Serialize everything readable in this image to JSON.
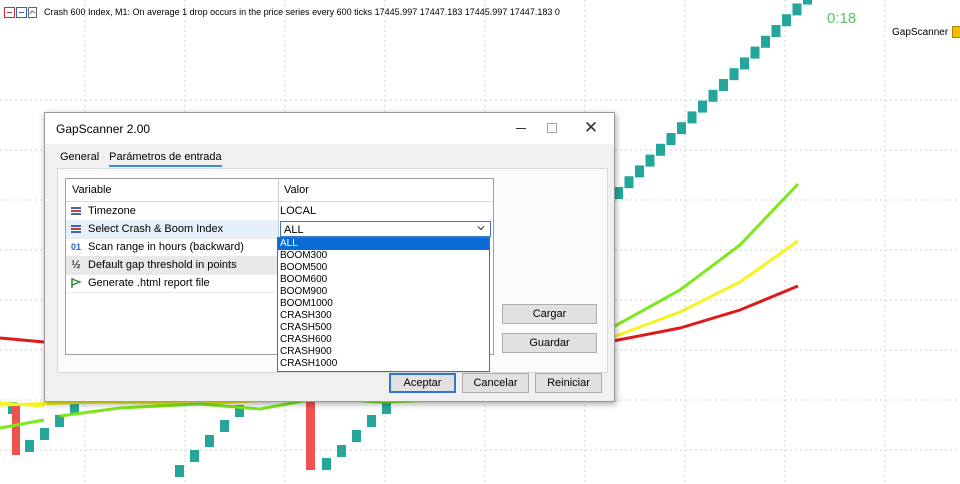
{
  "chart": {
    "header_text": "Crash 600 Index, M1:  On average 1 drop occurs in the price series every 600 ticks  17445.997 17447.183 17445.997 17447.183  0",
    "timer": "0:18",
    "ea_name": "GapScanner",
    "colors": {
      "bull_candle": "#26a69a",
      "bear_candle": "#ef5350",
      "ma_green": "#7de81c",
      "ma_yellow": "#f5f51e",
      "ma_red": "#e01919",
      "grid": "#d2d2d2"
    }
  },
  "dialog": {
    "title": "GapScanner 2.00",
    "close_glyph": "✕",
    "tabs": [
      {
        "label": "General",
        "active": false
      },
      {
        "label": "Parámetros de entrada",
        "active": true
      }
    ],
    "grid": {
      "headers": {
        "variable": "Variable",
        "value": "Valor"
      },
      "rows": [
        {
          "label": "Timezone",
          "value": "LOCAL",
          "icon": "enum-icon"
        },
        {
          "label": "Select Crash & Boom Index",
          "value": "ALL",
          "icon": "enum-icon"
        },
        {
          "label": "Scan range in hours (backward)",
          "value": "",
          "icon": "integer-icon",
          "icon_text": "01"
        },
        {
          "label": "Default gap threshold in points",
          "value": "",
          "icon": "fraction-icon",
          "icon_text": "½"
        },
        {
          "label": "Generate .html report file",
          "value": "",
          "icon": "bool-icon"
        }
      ]
    },
    "dropdown_options": [
      "ALL",
      "BOOM300",
      "BOOM500",
      "BOOM600",
      "BOOM900",
      "BOOM1000",
      "CRASH300",
      "CRASH500",
      "CRASH600",
      "CRASH900",
      "CRASH1000"
    ],
    "dropdown_selected": "ALL",
    "buttons": {
      "load": "Cargar",
      "save": "Guardar",
      "ok": "Aceptar",
      "cancel": "Cancelar",
      "reset": "Reiniciar"
    }
  }
}
